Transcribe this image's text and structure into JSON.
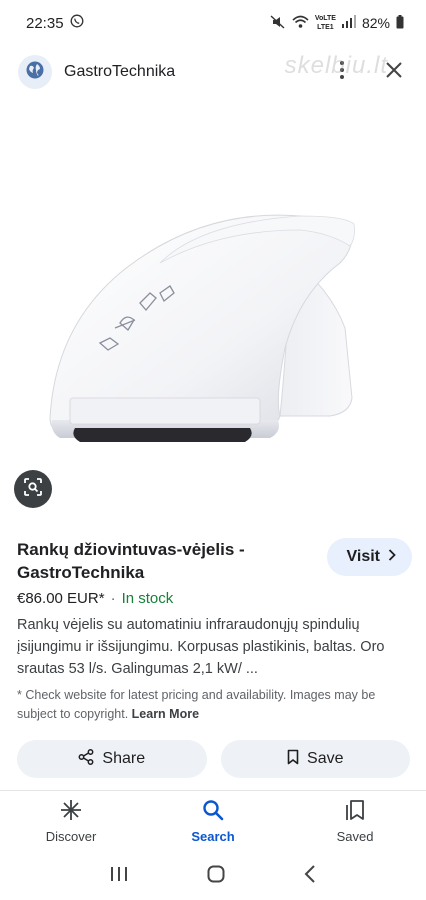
{
  "status_bar": {
    "time": "22:35",
    "network_top": "VoLTE",
    "network_bottom": "LTE1",
    "battery": "82%"
  },
  "header": {
    "site_name": "GastroTechnika",
    "watermark": "skelbiu.lt"
  },
  "product": {
    "title": "Rankų džiovintuvas-vėjelis - GastroTechnika",
    "visit_label": "Visit",
    "price": "€86.00 EUR*",
    "separator": "·",
    "stock": "In stock",
    "description": "Rankų vėjelis su automatiniu infraraudonųjų spindulių įsijungimu ir išsijungimu. Korpusas plastikinis, baltas. Oro srautas 53 l/s. Galingumas 2,1 kW/ ...",
    "disclaimer": "* Check website for latest pricing and availability. Images may be subject to copyright.",
    "learn_more": "Learn More"
  },
  "actions": {
    "share_label": "Share",
    "save_label": "Save"
  },
  "bottom_nav": {
    "items": [
      {
        "label": "Discover",
        "icon": "asterisk-icon"
      },
      {
        "label": "Search",
        "icon": "search-icon",
        "active": true
      },
      {
        "label": "Saved",
        "icon": "collections-icon"
      }
    ]
  },
  "colors": {
    "accent": "#0b57d0",
    "in_stock": "#188038",
    "pill_bg": "#eef1f5",
    "visit_bg": "#e8effd"
  }
}
